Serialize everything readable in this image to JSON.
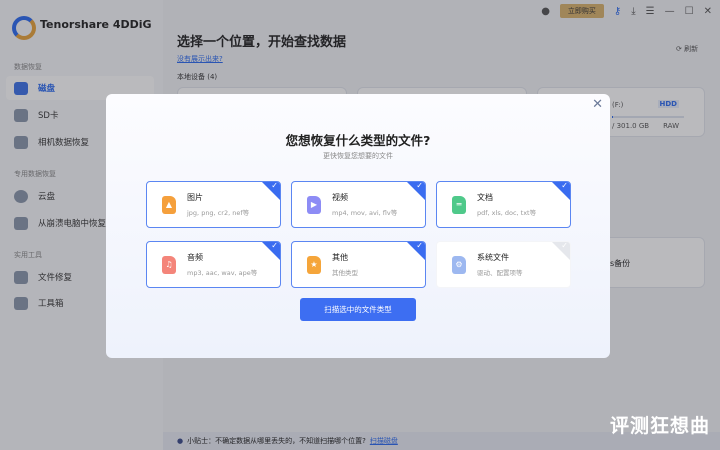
{
  "app": {
    "name": "Tenorshare 4DDiG"
  },
  "topbar": {
    "buy_label": "立即购买",
    "icons": [
      "robot-icon",
      "key-icon",
      "download-icon",
      "menu-icon",
      "minimize-icon",
      "maximize-icon",
      "close-icon"
    ]
  },
  "sidebar": {
    "sections": [
      {
        "label": "数据恢复"
      },
      {
        "label": "专用数据恢复"
      },
      {
        "label": "实用工具"
      }
    ],
    "items": [
      {
        "label": "磁盘"
      },
      {
        "label": "SD卡"
      },
      {
        "label": "相机数据恢复"
      },
      {
        "label": "云盘"
      },
      {
        "label": "从崩溃电脑中恢复"
      },
      {
        "label": "文件修复"
      },
      {
        "label": "工具箱"
      }
    ]
  },
  "main": {
    "title": "选择一个位置，开始查找数据",
    "link": "没有展示出来?",
    "local_devices": "本地设备 (4)",
    "refresh": "刷新",
    "device": {
      "name": "(F:)",
      "type": "HDD",
      "size": "/ 301.0 GB",
      "fs": "RAW",
      "usage_fraction": 0.02
    },
    "backup_label": "s备份"
  },
  "tip": {
    "text": "小贴士：不确定数据从哪里丢失的，不知道扫描哪个位置?",
    "link": "扫描磁盘"
  },
  "modal": {
    "title": "您想恢复什么类型的文件?",
    "subtitle": "更快恢复您想要的文件",
    "scan_button": "扫描选中的文件类型",
    "types": [
      {
        "name": "图片",
        "desc": "jpg, png, cr2, nef等",
        "checked": true,
        "color": "#f5a03c"
      },
      {
        "name": "视频",
        "desc": "mp4, mov, avi, flv等",
        "checked": true,
        "color": "#8d8cf5"
      },
      {
        "name": "文档",
        "desc": "pdf, xls, doc, txt等",
        "checked": true,
        "color": "#4fc98a"
      },
      {
        "name": "音频",
        "desc": "mp3, aac, wav, ape等",
        "checked": true,
        "color": "#f4857a"
      },
      {
        "name": "其他",
        "desc": "其他类型",
        "checked": true,
        "color": "#f5a53a"
      },
      {
        "name": "系统文件",
        "desc": "驱动、配置项等",
        "checked": false,
        "color": "#9db8f0"
      }
    ]
  },
  "watermark": "评测狂想曲"
}
